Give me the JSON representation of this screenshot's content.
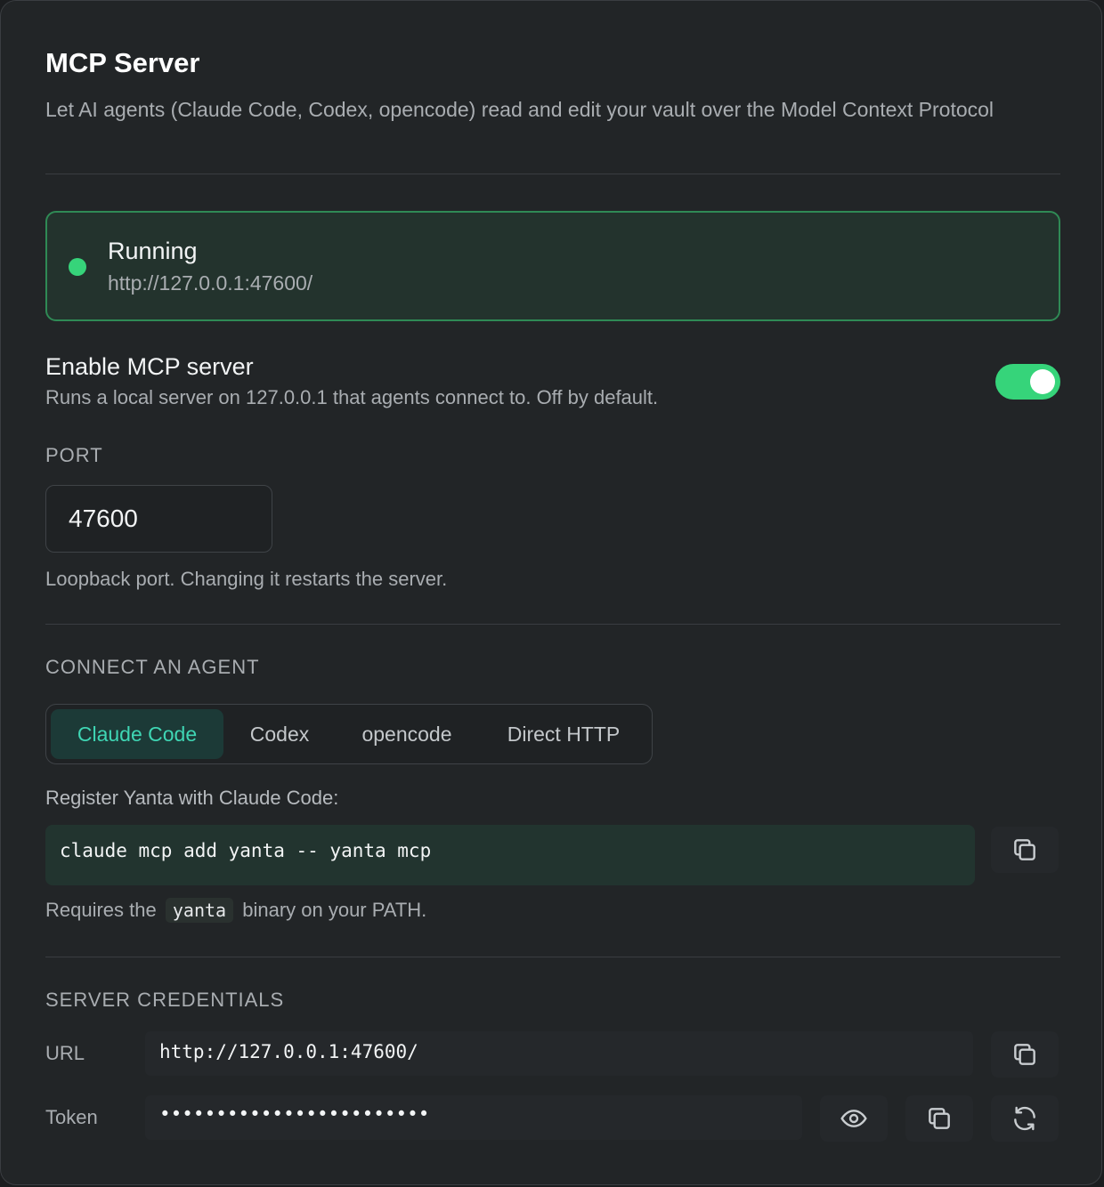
{
  "header": {
    "title": "MCP Server",
    "subtitle": "Let AI agents (Claude Code, Codex, opencode) read and edit your vault over the Model Context Protocol"
  },
  "status": {
    "state": "Running",
    "url": "http://127.0.0.1:47600/",
    "color": "#36d47a"
  },
  "enable": {
    "title": "Enable MCP server",
    "description": "Runs a local server on 127.0.0.1 that agents connect to. Off by default.",
    "enabled": true
  },
  "port": {
    "label": "PORT",
    "value": "47600",
    "help": "Loopback port. Changing it restarts the server."
  },
  "connect": {
    "label": "CONNECT AN AGENT",
    "tabs": [
      {
        "label": "Claude Code",
        "active": true
      },
      {
        "label": "Codex",
        "active": false
      },
      {
        "label": "opencode",
        "active": false
      },
      {
        "label": "Direct HTTP",
        "active": false
      }
    ],
    "register_text": "Register Yanta with Claude Code:",
    "command": "claude mcp add yanta -- yanta mcp",
    "requires_prefix": "Requires the",
    "requires_code": "yanta",
    "requires_suffix": "binary on your PATH."
  },
  "credentials": {
    "label": "SERVER CREDENTIALS",
    "url_label": "URL",
    "url_value": "http://127.0.0.1:47600/",
    "token_label": "Token",
    "token_value": "••••••••••••••••••••••••"
  },
  "icons": [
    "copy-icon",
    "eye-icon",
    "refresh-icon"
  ]
}
